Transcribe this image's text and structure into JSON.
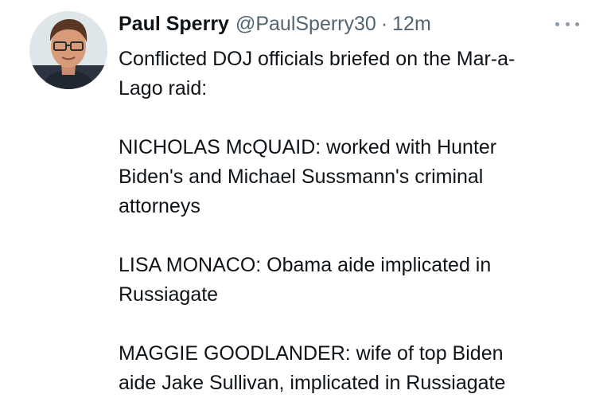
{
  "tweet": {
    "author_name": "Paul Sperry",
    "handle": "@PaulSperry30",
    "separator": "·",
    "timestamp": "12m",
    "more_icon": "ellipsis-icon",
    "paragraphs": [
      [
        "Conflicted DOJ officials briefed on the Mar-a-",
        "Lago raid:"
      ],
      [
        "NICHOLAS McQUAID: worked with Hunter",
        "Biden's and Michael Sussmann's criminal",
        "attorneys"
      ],
      [
        "LISA MONACO: Obama aide implicated in",
        "Russiagate"
      ],
      [
        "MAGGIE GOODLANDER: wife of top Biden",
        "aide Jake Sullivan, implicated in Russiagate"
      ]
    ]
  },
  "colors": {
    "text": "#0f1419",
    "secondary": "#536471",
    "background": "#ffffff"
  }
}
